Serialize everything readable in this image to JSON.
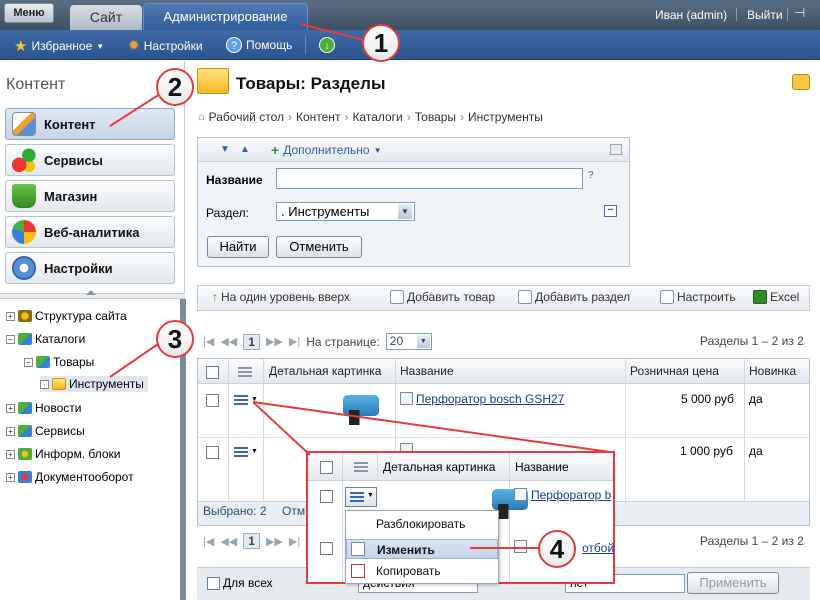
{
  "topbar": {
    "menu_label": "Меню",
    "tab_site": "Сайт",
    "tab_admin": "Администрирование",
    "user": "Иван (admin)",
    "logout": "Выйти"
  },
  "toolbar": {
    "favorites": "Избранное",
    "settings": "Настройки",
    "help": "Помощь"
  },
  "sidebar": {
    "header": "Контент",
    "items": [
      {
        "label": "Контент",
        "icon": "pencil-icon"
      },
      {
        "label": "Сервисы",
        "icon": "shapes-icon"
      },
      {
        "label": "Магазин",
        "icon": "cart-icon"
      },
      {
        "label": "Веб-аналитика",
        "icon": "pie-chart-icon"
      },
      {
        "label": "Настройки",
        "icon": "gear-icon"
      }
    ],
    "tree": [
      {
        "label": "Структура сайта",
        "level": 0
      },
      {
        "label": "Каталоги",
        "level": 0
      },
      {
        "label": "Товары",
        "level": 1
      },
      {
        "label": "Инструменты",
        "level": 2
      },
      {
        "label": "Новости",
        "level": 0
      },
      {
        "label": "Сервисы",
        "level": 0
      },
      {
        "label": "Информ. блоки",
        "level": 0
      },
      {
        "label": "Документооборот",
        "level": 0
      }
    ]
  },
  "main": {
    "title": "Товары: Разделы",
    "breadcrumb": [
      "Рабочий стол",
      "Контент",
      "Каталоги",
      "Товары",
      "Инструменты"
    ],
    "filter": {
      "extra": "Дополнительно",
      "name_label": "Название",
      "name_value": "",
      "help": "?",
      "section_label": "Раздел:",
      "section_value": ". Инструменты",
      "find": "Найти",
      "cancel": "Отменить"
    },
    "actions": {
      "level_up": "На один уровень вверх",
      "add_item": "Добавить товар",
      "add_section": "Добавить раздел",
      "configure": "Настроить",
      "excel": "Excel"
    },
    "pager": {
      "page": "1",
      "per_page_label": "На странице:",
      "per_page": "20",
      "summary": "Разделы 1 – 2 из 2"
    },
    "grid": {
      "headers": [
        "Детальная картинка",
        "Название",
        "Розничная цена",
        "Новинка"
      ],
      "rows": [
        {
          "name": "Перфоратор bosch GSH27",
          "price": "5 000 руб",
          "new": "да"
        },
        {
          "name": "Молоток отбойный BOSCH GSH 5E",
          "price": "1 000 руб",
          "new": "да"
        }
      ],
      "selected": "Выбрано: 2",
      "selected_more": "Отм"
    },
    "bottom": {
      "for_all": "Для всех",
      "actions": "действия",
      "not": "нет",
      "apply": "Применить"
    }
  },
  "popup": {
    "headers": [
      "Детальная картинка",
      "Название"
    ],
    "row_name": "Перфоратор b",
    "row2_text": "отбой",
    "menu": [
      "Разблокировать",
      "Изменить",
      "Копировать"
    ]
  },
  "callouts": [
    "1",
    "2",
    "3",
    "4"
  ]
}
